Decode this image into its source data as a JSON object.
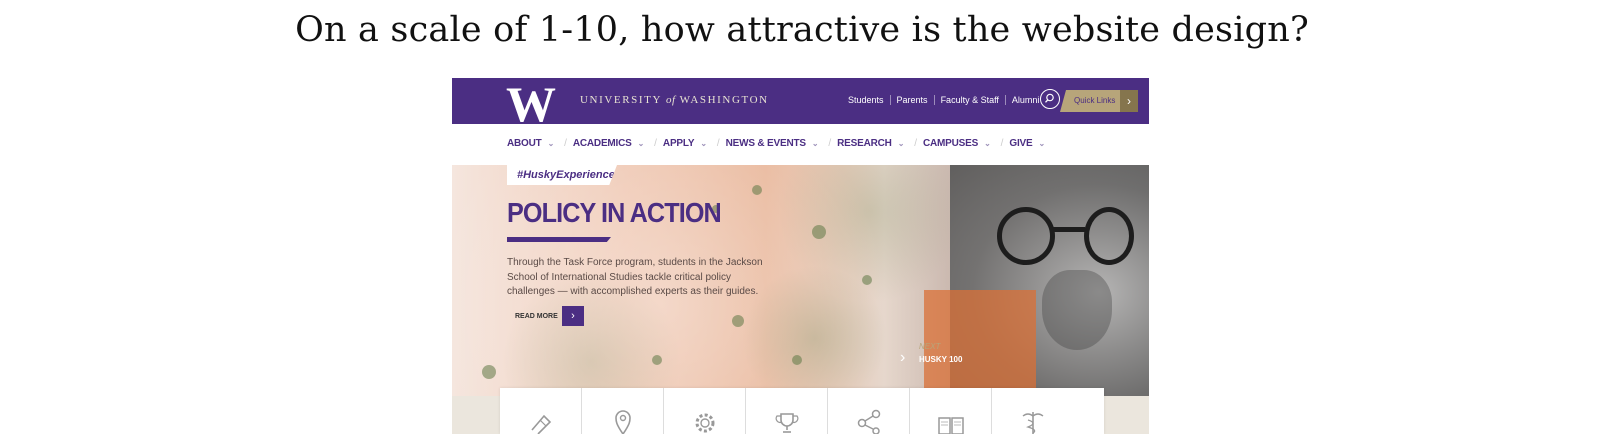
{
  "question": "On a scale of 1-10, how attractive is the website design?",
  "header": {
    "logo_letter": "W",
    "university_pre": "UNIVERSITY",
    "university_of": "of",
    "university_post": "WASHINGTON",
    "links": [
      "Students",
      "Parents",
      "Faculty & Staff",
      "Alumni"
    ],
    "quick_links_label": "Quick Links",
    "colors": {
      "purple": "#4b2e83",
      "gold": "#b7a57a"
    }
  },
  "nav": {
    "items": [
      "ABOUT",
      "ACADEMICS",
      "APPLY",
      "NEWS & EVENTS",
      "RESEARCH",
      "CAMPUSES",
      "GIVE"
    ]
  },
  "hero": {
    "tag": "#HuskyExperience",
    "title": "POLICY IN ACTION",
    "body": "Through the Task Force program, students in the Jackson School of International Studies tackle critical policy challenges — with accomplished experts as their guides.",
    "read_more": "READ MORE",
    "next_label": "NEXT",
    "next_title": "HUSKY 100"
  },
  "icon_bar": {
    "icons": [
      "ticket-icon",
      "map-pin-icon",
      "gear-icon",
      "trophy-icon",
      "share-icon",
      "book-icon",
      "caduceus-icon"
    ]
  }
}
